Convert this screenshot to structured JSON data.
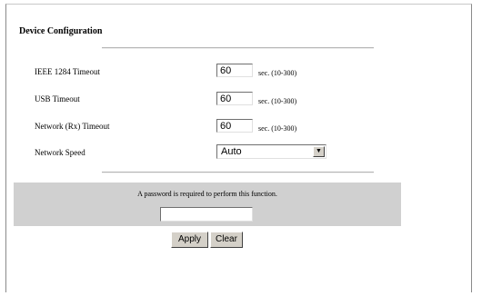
{
  "page": {
    "title": "Device Configuration"
  },
  "fields": [
    {
      "label": "IEEE 1284 Timeout",
      "value": "60",
      "range": "sec. (10-300)"
    },
    {
      "label": "USB Timeout",
      "value": "60",
      "range": "sec. (10-300)"
    },
    {
      "label": "Network (Rx) Timeout",
      "value": "60",
      "range": "sec. (10-300)"
    }
  ],
  "network_speed": {
    "label": "Network Speed",
    "selected": "Auto",
    "icon": "chevron-down-icon"
  },
  "password": {
    "prompt": "A password is required to perform this function.",
    "value": ""
  },
  "buttons": {
    "apply": "Apply",
    "clear": "Clear"
  }
}
